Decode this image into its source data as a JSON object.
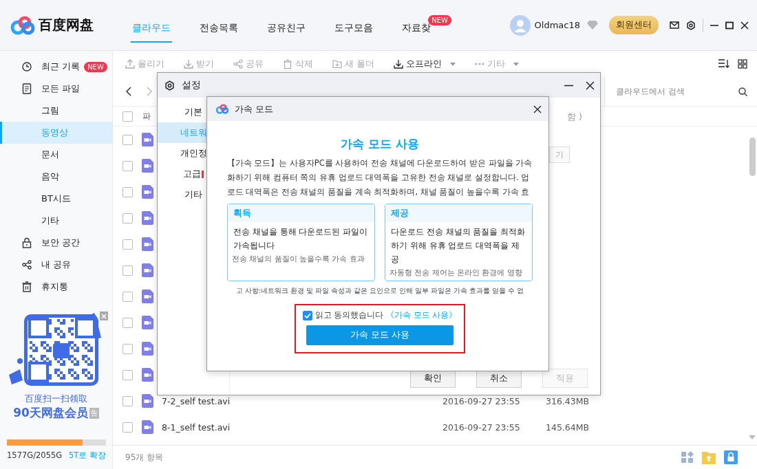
{
  "app": {
    "logo_text": "百度网盘"
  },
  "top_tabs": [
    {
      "label": "클라우드",
      "selected": true
    },
    {
      "label": "전송목록",
      "selected": false
    },
    {
      "label": "공유친구",
      "selected": false
    },
    {
      "label": "도구모음",
      "selected": false
    },
    {
      "label": "자료찾",
      "selected": false,
      "badge": "NEW"
    }
  ],
  "user": {
    "name": "Oldmac18",
    "vip_button": "회원센터"
  },
  "sidebar": {
    "items": [
      {
        "label": "최근 기록",
        "badge": "NEW",
        "selected": false
      },
      {
        "label": "모든 파일",
        "selected": false,
        "children": [
          {
            "label": "그림",
            "selected": false
          },
          {
            "label": "동영상",
            "selected": true
          },
          {
            "label": "문서",
            "selected": false
          },
          {
            "label": "음악",
            "selected": false
          },
          {
            "label": "BT시드",
            "selected": false
          },
          {
            "label": "기타",
            "selected": false
          }
        ]
      },
      {
        "label": "보안 공간",
        "selected": false
      },
      {
        "label": "내 공유",
        "selected": false
      },
      {
        "label": "휴지통",
        "selected": false
      }
    ],
    "promo": {
      "line1": "百度扫一扫领取",
      "line2": "90天网盘会员",
      "ad_label": "告"
    },
    "storage": {
      "usage": "1577G/2055G",
      "level": 0.767,
      "expand_link": "5T로 확장"
    }
  },
  "toolbar": [
    {
      "label": "올리기",
      "disabled": true
    },
    {
      "label": "받기",
      "disabled": true
    },
    {
      "label": "공유",
      "disabled": true
    },
    {
      "label": "삭제",
      "disabled": true
    },
    {
      "label": "새 폴더",
      "disabled": true
    },
    {
      "label": "오프라인",
      "disabled": false,
      "dropdown": true
    },
    {
      "label": "기타",
      "disabled": true,
      "dropdown": true
    }
  ],
  "search": {
    "placeholder": "클라우드에서 검색"
  },
  "table": {
    "columns": [
      "파"
    ],
    "header_checked": false,
    "rows": [
      {
        "checked": false
      },
      {
        "checked": false
      },
      {
        "checked": false
      },
      {
        "checked": false
      },
      {
        "checked": false
      },
      {
        "checked": false
      },
      {
        "checked": false
      },
      {
        "checked": false
      },
      {
        "checked": false
      },
      {
        "checked": false
      },
      {
        "checked": false,
        "name": "7-2_self test.avi",
        "date": "2016-09-27 23:55",
        "size": "316.43MB"
      },
      {
        "checked": false,
        "name": "8-1_self test.avi",
        "date": "2016-09-27 23:55",
        "size": "145.64MB"
      }
    ]
  },
  "status_bar": {
    "count": "95개 항목"
  },
  "settings_dialog": {
    "title": "설정",
    "nav": [
      {
        "label": "기본",
        "selected": false,
        "alert": false
      },
      {
        "label": "네트워",
        "selected": true,
        "alert": false
      },
      {
        "label": "개인정",
        "selected": false,
        "alert": false
      },
      {
        "label": "고급",
        "selected": false,
        "alert": true
      },
      {
        "label": "기타",
        "selected": false,
        "alert": false
      }
    ],
    "content_fragment": "함 )",
    "content_button": "기",
    "buttons": [
      {
        "label": "확인",
        "disabled": false
      },
      {
        "label": "취소",
        "disabled": false
      },
      {
        "label": "적용",
        "disabled": true
      }
    ]
  },
  "accel_dialog": {
    "title": "가속 모드",
    "heading": "가속 모드 사용",
    "description": "【가속 모드】는 사용자PC를 사용하여 전송 채널에 다운로드하여 받은 파일을 가속화하기 위해 컴퓨터 쪽의 유휴 업로드 대역폭을 고유한 전송 채널로 설정합니다. 업로드 대역폭은 전송 채널의 품질을 계속 최적화하며, 채널 품질이 높을수록 가속 효",
    "cards": [
      {
        "title": "획득",
        "body": "전송 채널을 통해 다운로드된 파일이 가속됩니다",
        "note": "전송 채널의 품질이 높을수록 가속 효과"
      },
      {
        "title": "제공",
        "body": "다운로드 전송 채널의 품질을 최적화하기 위해 유휴 업로드 대역폭을 제공",
        "note": "자동형 전송 제어는 온라인 환경에 영향"
      }
    ],
    "notice": "고 사항:네트워크 환경 및 파일 속성과 같은 요인으로 인해 일부 파일은 가속 효과를 얻을 수 없",
    "agree": {
      "checked": true,
      "text": "읽고 동의했습니다",
      "link": "《가속 모드 사용》"
    },
    "confirm_button": "가속 모드 사용"
  }
}
